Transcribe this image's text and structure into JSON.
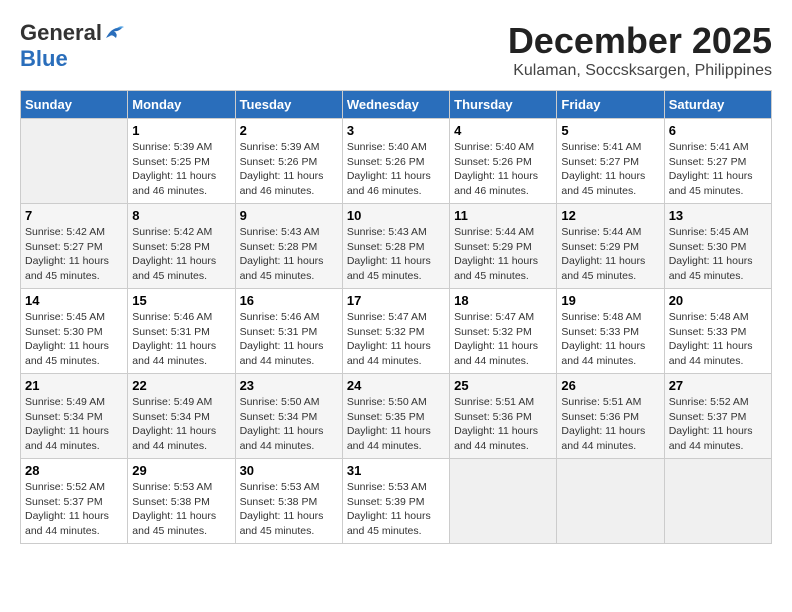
{
  "header": {
    "logo_line1": "General",
    "logo_line2": "Blue",
    "month": "December 2025",
    "location": "Kulaman, Soccsksargen, Philippines"
  },
  "days_of_week": [
    "Sunday",
    "Monday",
    "Tuesday",
    "Wednesday",
    "Thursday",
    "Friday",
    "Saturday"
  ],
  "weeks": [
    [
      {
        "day": "",
        "info": ""
      },
      {
        "day": "1",
        "info": "Sunrise: 5:39 AM\nSunset: 5:25 PM\nDaylight: 11 hours\nand 46 minutes."
      },
      {
        "day": "2",
        "info": "Sunrise: 5:39 AM\nSunset: 5:26 PM\nDaylight: 11 hours\nand 46 minutes."
      },
      {
        "day": "3",
        "info": "Sunrise: 5:40 AM\nSunset: 5:26 PM\nDaylight: 11 hours\nand 46 minutes."
      },
      {
        "day": "4",
        "info": "Sunrise: 5:40 AM\nSunset: 5:26 PM\nDaylight: 11 hours\nand 46 minutes."
      },
      {
        "day": "5",
        "info": "Sunrise: 5:41 AM\nSunset: 5:27 PM\nDaylight: 11 hours\nand 45 minutes."
      },
      {
        "day": "6",
        "info": "Sunrise: 5:41 AM\nSunset: 5:27 PM\nDaylight: 11 hours\nand 45 minutes."
      }
    ],
    [
      {
        "day": "7",
        "info": "Sunrise: 5:42 AM\nSunset: 5:27 PM\nDaylight: 11 hours\nand 45 minutes."
      },
      {
        "day": "8",
        "info": "Sunrise: 5:42 AM\nSunset: 5:28 PM\nDaylight: 11 hours\nand 45 minutes."
      },
      {
        "day": "9",
        "info": "Sunrise: 5:43 AM\nSunset: 5:28 PM\nDaylight: 11 hours\nand 45 minutes."
      },
      {
        "day": "10",
        "info": "Sunrise: 5:43 AM\nSunset: 5:28 PM\nDaylight: 11 hours\nand 45 minutes."
      },
      {
        "day": "11",
        "info": "Sunrise: 5:44 AM\nSunset: 5:29 PM\nDaylight: 11 hours\nand 45 minutes."
      },
      {
        "day": "12",
        "info": "Sunrise: 5:44 AM\nSunset: 5:29 PM\nDaylight: 11 hours\nand 45 minutes."
      },
      {
        "day": "13",
        "info": "Sunrise: 5:45 AM\nSunset: 5:30 PM\nDaylight: 11 hours\nand 45 minutes."
      }
    ],
    [
      {
        "day": "14",
        "info": "Sunrise: 5:45 AM\nSunset: 5:30 PM\nDaylight: 11 hours\nand 45 minutes."
      },
      {
        "day": "15",
        "info": "Sunrise: 5:46 AM\nSunset: 5:31 PM\nDaylight: 11 hours\nand 44 minutes."
      },
      {
        "day": "16",
        "info": "Sunrise: 5:46 AM\nSunset: 5:31 PM\nDaylight: 11 hours\nand 44 minutes."
      },
      {
        "day": "17",
        "info": "Sunrise: 5:47 AM\nSunset: 5:32 PM\nDaylight: 11 hours\nand 44 minutes."
      },
      {
        "day": "18",
        "info": "Sunrise: 5:47 AM\nSunset: 5:32 PM\nDaylight: 11 hours\nand 44 minutes."
      },
      {
        "day": "19",
        "info": "Sunrise: 5:48 AM\nSunset: 5:33 PM\nDaylight: 11 hours\nand 44 minutes."
      },
      {
        "day": "20",
        "info": "Sunrise: 5:48 AM\nSunset: 5:33 PM\nDaylight: 11 hours\nand 44 minutes."
      }
    ],
    [
      {
        "day": "21",
        "info": "Sunrise: 5:49 AM\nSunset: 5:34 PM\nDaylight: 11 hours\nand 44 minutes."
      },
      {
        "day": "22",
        "info": "Sunrise: 5:49 AM\nSunset: 5:34 PM\nDaylight: 11 hours\nand 44 minutes."
      },
      {
        "day": "23",
        "info": "Sunrise: 5:50 AM\nSunset: 5:34 PM\nDaylight: 11 hours\nand 44 minutes."
      },
      {
        "day": "24",
        "info": "Sunrise: 5:50 AM\nSunset: 5:35 PM\nDaylight: 11 hours\nand 44 minutes."
      },
      {
        "day": "25",
        "info": "Sunrise: 5:51 AM\nSunset: 5:36 PM\nDaylight: 11 hours\nand 44 minutes."
      },
      {
        "day": "26",
        "info": "Sunrise: 5:51 AM\nSunset: 5:36 PM\nDaylight: 11 hours\nand 44 minutes."
      },
      {
        "day": "27",
        "info": "Sunrise: 5:52 AM\nSunset: 5:37 PM\nDaylight: 11 hours\nand 44 minutes."
      }
    ],
    [
      {
        "day": "28",
        "info": "Sunrise: 5:52 AM\nSunset: 5:37 PM\nDaylight: 11 hours\nand 44 minutes."
      },
      {
        "day": "29",
        "info": "Sunrise: 5:53 AM\nSunset: 5:38 PM\nDaylight: 11 hours\nand 45 minutes."
      },
      {
        "day": "30",
        "info": "Sunrise: 5:53 AM\nSunset: 5:38 PM\nDaylight: 11 hours\nand 45 minutes."
      },
      {
        "day": "31",
        "info": "Sunrise: 5:53 AM\nSunset: 5:39 PM\nDaylight: 11 hours\nand 45 minutes."
      },
      {
        "day": "",
        "info": ""
      },
      {
        "day": "",
        "info": ""
      },
      {
        "day": "",
        "info": ""
      }
    ]
  ]
}
